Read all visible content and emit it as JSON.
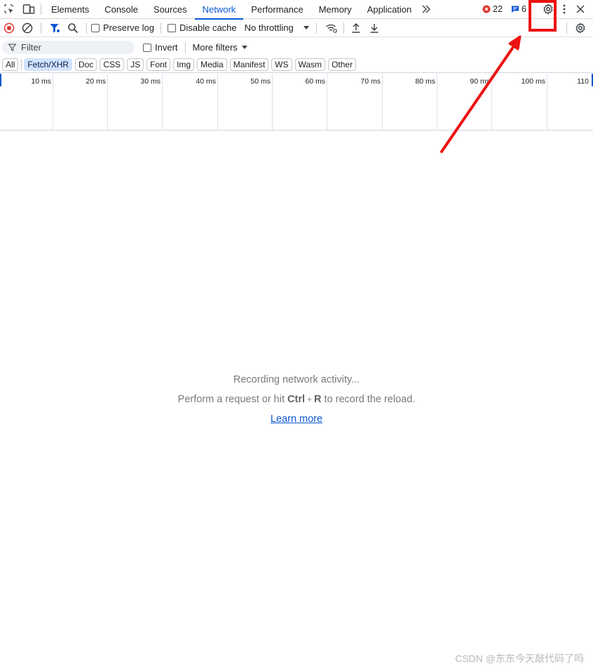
{
  "tabs": [
    "Elements",
    "Console",
    "Sources",
    "Network",
    "Performance",
    "Memory",
    "Application"
  ],
  "active_tab": "Network",
  "status": {
    "errors": "22",
    "messages": "6"
  },
  "toolbar": {
    "preserve_log": "Preserve log",
    "disable_cache": "Disable cache",
    "throttling": "No throttling"
  },
  "filter": {
    "placeholder": "Filter",
    "invert": "Invert",
    "more_filters": "More filters"
  },
  "types": [
    "All",
    "Fetch/XHR",
    "Doc",
    "CSS",
    "JS",
    "Font",
    "Img",
    "Media",
    "Manifest",
    "WS",
    "Wasm",
    "Other"
  ],
  "active_type": "Fetch/XHR",
  "timeline": [
    "10 ms",
    "20 ms",
    "30 ms",
    "40 ms",
    "50 ms",
    "60 ms",
    "70 ms",
    "80 ms",
    "90 ms",
    "100 ms",
    "110"
  ],
  "empty": {
    "recording": "Recording network activity...",
    "perform_prefix": "Perform a request or hit",
    "shortcut_key1": "Ctrl",
    "shortcut_plus": "+",
    "shortcut_key2": "R",
    "perform_suffix": "to record the reload.",
    "learn_more": "Learn more"
  },
  "watermark": "CSDN @东东今天敲代码了吗",
  "colors": {
    "accent": "#0b57d0",
    "error": "#dc362e",
    "annotation": "#ee1111",
    "chip_active": "#d3e3fd"
  },
  "icons": [
    "inspect-element-icon",
    "device-toolbar-icon",
    "chevron-double-right-icon",
    "error-icon",
    "message-icon",
    "gear-icon",
    "more-vert-icon",
    "close-icon",
    "record-stop-icon",
    "clear-icon",
    "filter-funnel-icon",
    "search-icon",
    "network-conditions-icon",
    "upload-icon",
    "download-icon",
    "filter-icon"
  ]
}
